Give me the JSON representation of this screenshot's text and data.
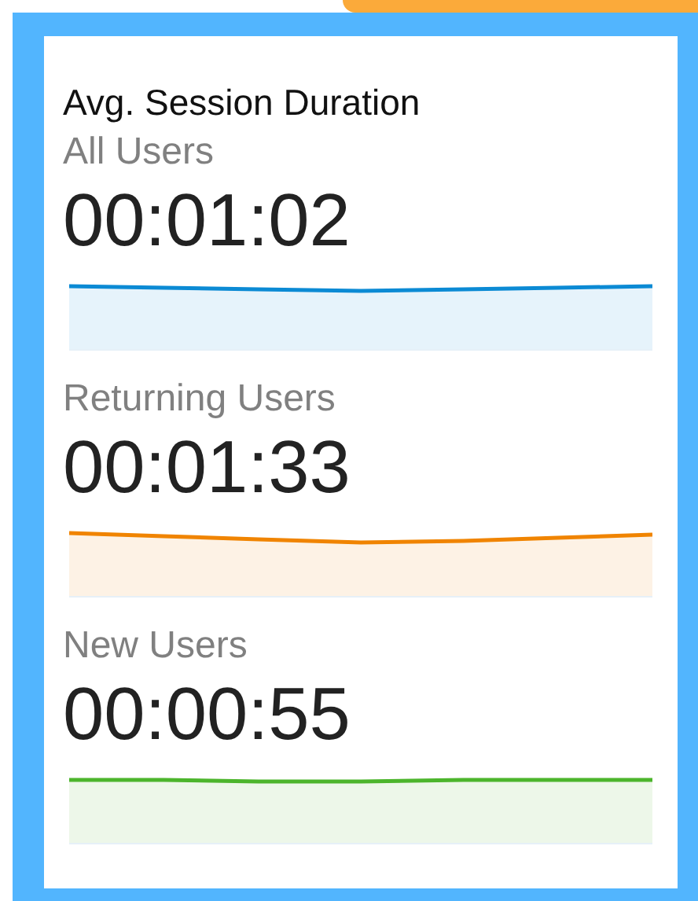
{
  "title": "Avg. Session Duration",
  "segments": [
    {
      "label": "All Users",
      "value": "00:01:02",
      "color": "#0b8ad4"
    },
    {
      "label": "Returning Users",
      "value": "00:01:33",
      "color": "#f08400"
    },
    {
      "label": "New Users",
      "value": "00:00:55",
      "color": "#4cb52c"
    }
  ]
}
